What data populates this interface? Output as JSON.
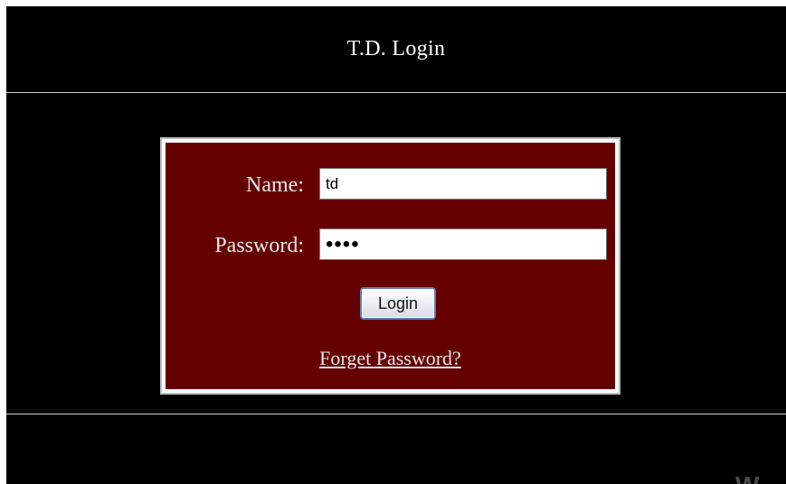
{
  "page": {
    "title": "T.D. Login"
  },
  "login_form": {
    "name_label": "Name:",
    "name_value": "td",
    "password_label": "Password:",
    "password_value": "••••",
    "login_button_label": "Login",
    "forgot_password_link": "Forget Password?"
  },
  "watermark": {
    "visible_fragment": "W"
  },
  "colors": {
    "page_background": "#000000",
    "form_background": "#650000",
    "form_border": "#ffffff",
    "text": "#e8e8e8"
  }
}
